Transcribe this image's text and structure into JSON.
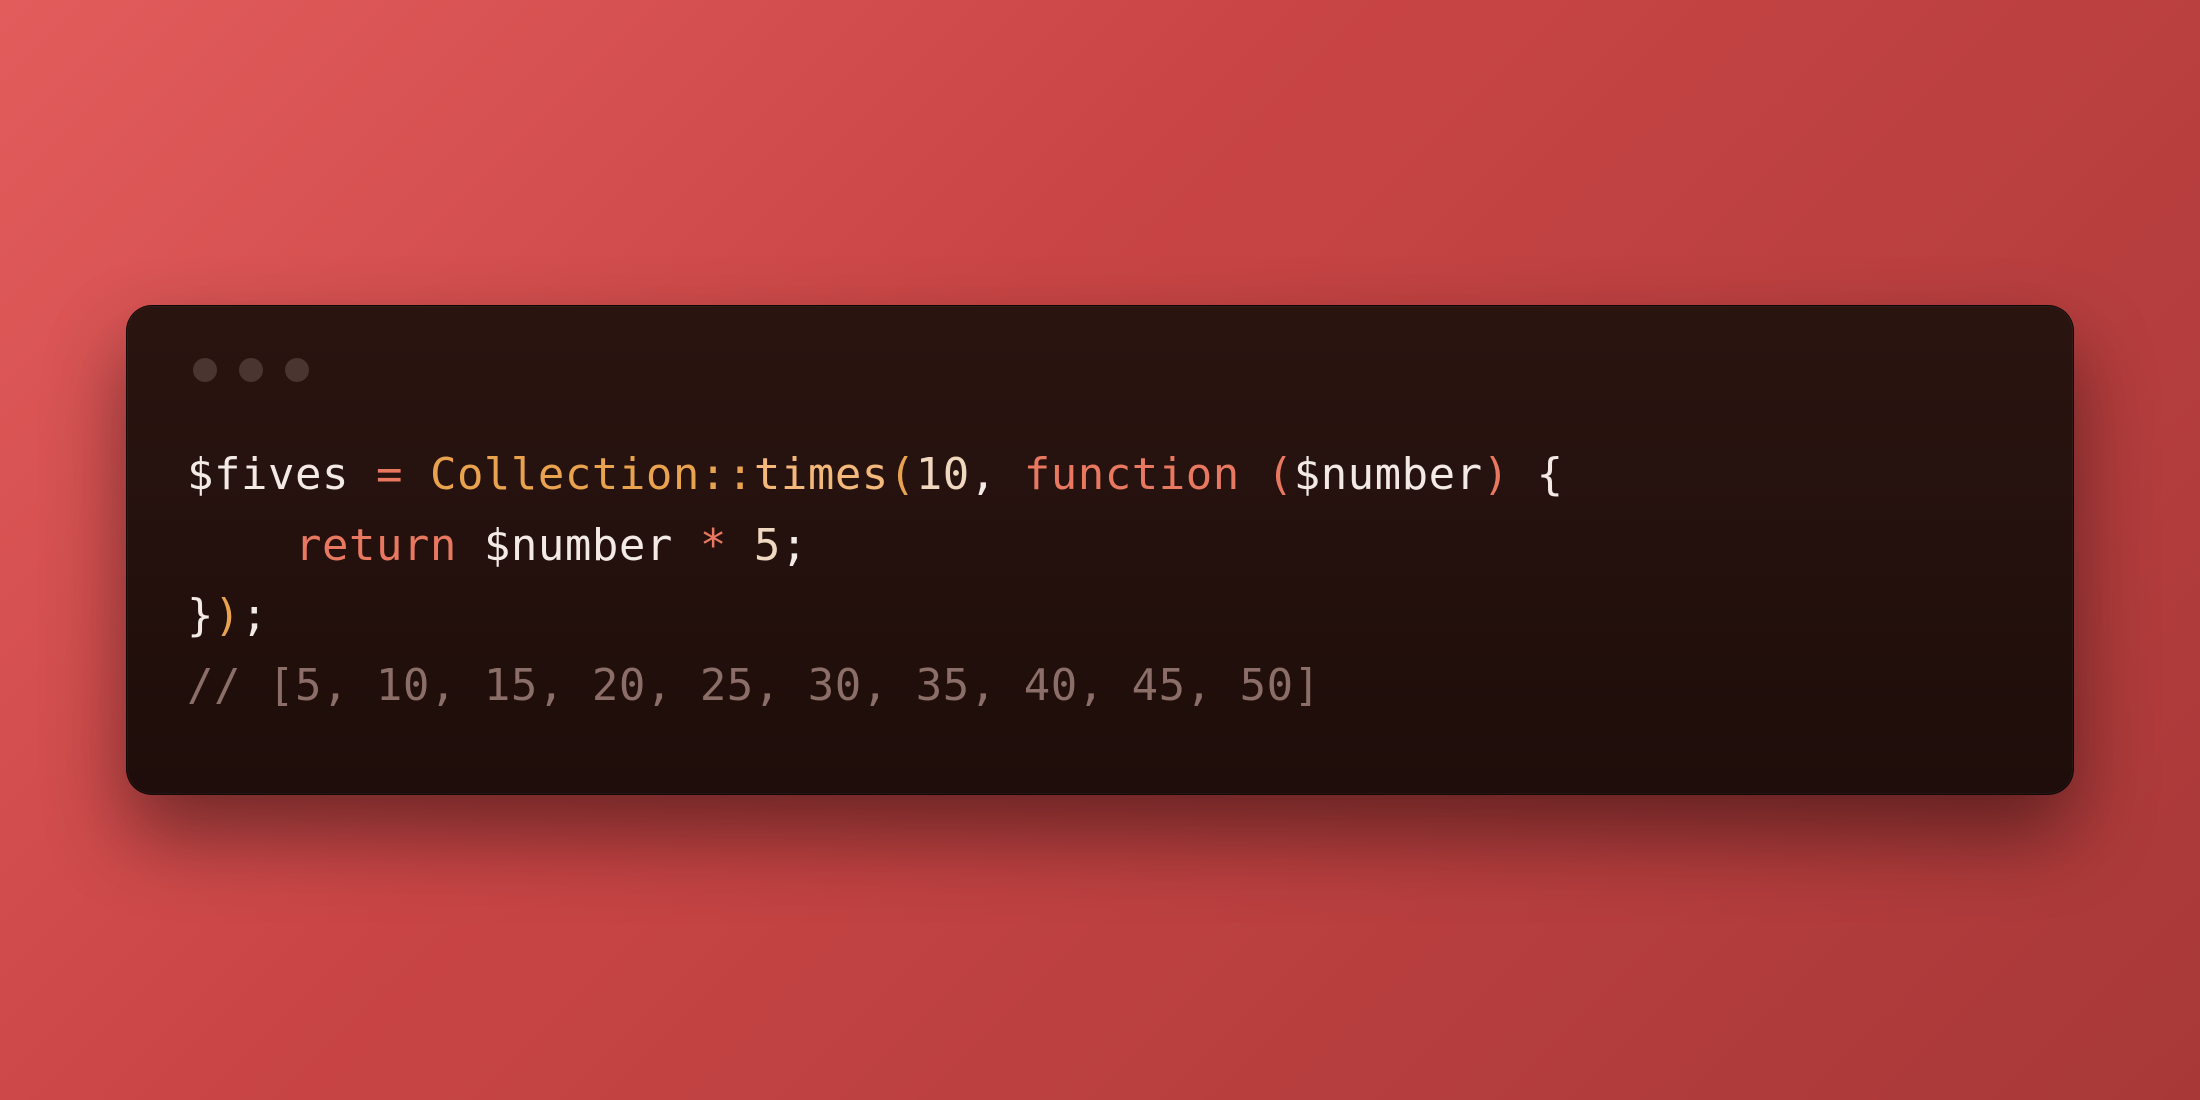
{
  "code": {
    "line1": {
      "v1": "$fives",
      "sp1": " ",
      "eq": "=",
      "sp2": " ",
      "cls": "Collection",
      "dcol": "::",
      "method": "times",
      "lpar": "(",
      "n1": "10",
      "comma": ",",
      "sp3": " ",
      "fn": "function",
      "sp4": " ",
      "lpar2": "(",
      "arg": "$number",
      "rpar2": ")",
      "sp5": " ",
      "lbrace": "{"
    },
    "line2": {
      "indent": "    ",
      "ret": "return",
      "sp1": " ",
      "var": "$number",
      "sp2": " ",
      "star": "*",
      "sp3": " ",
      "n": "5",
      "semi": ";"
    },
    "line3": {
      "rbrace": "}",
      "rpar": ")",
      "semi": ";"
    },
    "line4": {
      "comment": "// [5, 10, 15, 20, 25, 30, 35, 40, 45, 50]"
    }
  }
}
